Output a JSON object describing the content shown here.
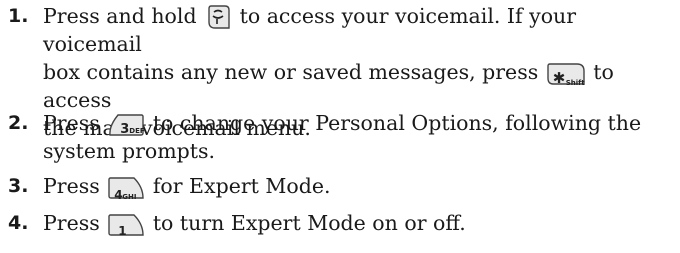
{
  "steps": [
    {
      "number": "1.",
      "lines": [
        {
          "a": "Press and hold ",
          "key": "voicemail-key",
          "b": " to access your voicemail. If your voicemail"
        },
        {
          "a": "box contains any new or saved messages, press ",
          "key": "star-shift-key",
          "b": " to access"
        },
        {
          "a": "the main voicemail menu.",
          "key": null,
          "b": ""
        }
      ]
    },
    {
      "number": "2.",
      "lines": [
        {
          "a": "Press ",
          "key": "3-def-key",
          "b": " to change your Personal Options, following the"
        },
        {
          "a": "system prompts.",
          "key": null,
          "b": ""
        }
      ]
    },
    {
      "number": "3.",
      "lines": [
        {
          "a": "Press ",
          "key": "4-ghi-key",
          "b": " for Expert Mode."
        }
      ]
    },
    {
      "number": "4.",
      "lines": [
        {
          "a": "Press ",
          "key": "1-key",
          "b": " to turn Expert Mode on or off."
        }
      ]
    }
  ],
  "keys": {
    "star": {
      "glyph": "✱",
      "sub": "Shift"
    },
    "three": {
      "digit": "3",
      "sub": "DEF"
    },
    "four": {
      "digit": "4",
      "sub": "GHI"
    },
    "one": {
      "digit": "1"
    }
  }
}
